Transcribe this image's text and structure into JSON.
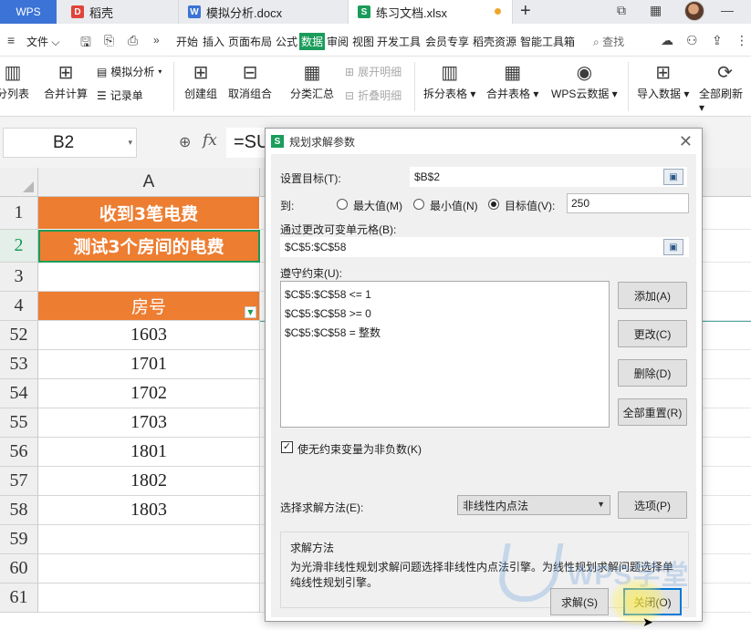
{
  "titlebar": {
    "app_tab": "WPS",
    "tabs": [
      {
        "label": "稻壳",
        "icon": "docer-icon"
      },
      {
        "label": "模拟分析.docx",
        "icon": "word-doc-icon"
      },
      {
        "label": "练习文档.xlsx",
        "icon": "sheet-doc-icon",
        "active": true
      }
    ]
  },
  "menubar": {
    "file": "文件",
    "items": [
      "开始",
      "插入",
      "页面布局",
      "公式",
      "数据",
      "审阅",
      "视图",
      "开发工具",
      "会员专享",
      "稻壳资源",
      "智能工具箱"
    ],
    "active_item": "数据",
    "search": "查找"
  },
  "ribbon": {
    "split_col": "分列表",
    "merge_calc": "合并计算",
    "what_if": "模拟分析",
    "record": "记录单",
    "group": "创建组",
    "ungroup": "取消组合",
    "subtotal": "分类汇总",
    "expand": "展开明细",
    "collapse": "折叠明细",
    "split_table": "拆分表格",
    "merge_table": "合并表格",
    "wps_cloud": "WPS云数据",
    "import": "导入数据",
    "refresh_all": "全部刷新"
  },
  "formula_bar": {
    "name_box": "B2",
    "fx": "fx",
    "formula": "=SUM("
  },
  "sheet": {
    "column_a": "A",
    "rows": [
      {
        "num": "1",
        "value": "收到3笔电费",
        "style": "orange"
      },
      {
        "num": "2",
        "value": "测试3个房间的电费",
        "style": "orange"
      },
      {
        "num": "3",
        "value": "",
        "style": "plain"
      },
      {
        "num": "4",
        "value": "房号",
        "style": "hdr"
      },
      {
        "num": "52",
        "value": "1603",
        "style": "plain"
      },
      {
        "num": "53",
        "value": "1701",
        "style": "plain"
      },
      {
        "num": "54",
        "value": "1702",
        "style": "plain"
      },
      {
        "num": "55",
        "value": "1703",
        "style": "plain"
      },
      {
        "num": "56",
        "value": "1801",
        "style": "plain"
      },
      {
        "num": "57",
        "value": "1802",
        "style": "plain"
      },
      {
        "num": "58",
        "value": "1803",
        "style": "plain"
      },
      {
        "num": "59",
        "value": "",
        "style": "plain"
      },
      {
        "num": "60",
        "value": "",
        "style": "plain"
      },
      {
        "num": "61",
        "value": "",
        "style": "plain"
      }
    ]
  },
  "dialog": {
    "title": "规划求解参数",
    "set_target_label": "设置目标(T):",
    "set_target_value": "$B$2",
    "to_label": "到:",
    "radio_max": "最大值(M)",
    "radio_min": "最小值(N)",
    "radio_value": "目标值(V):",
    "target_value": "250",
    "changing_cells_label": "通过更改可变单元格(B):",
    "changing_cells_value": "$C$5:$C$58",
    "constraints_label": "遵守约束(U):",
    "constraints": [
      "$C$5:$C$58 <= 1",
      "$C$5:$C$58 >= 0",
      "$C$5:$C$58 = 整数"
    ],
    "btn_add": "添加(A)",
    "btn_change": "更改(C)",
    "btn_delete": "删除(D)",
    "btn_reset": "全部重置(R)",
    "nonneg_label": "使无约束变量为非负数(K)",
    "nonneg_checked": true,
    "method_label": "选择求解方法(E):",
    "method_value": "非线性内点法",
    "btn_options": "选项(P)",
    "method_group_title": "求解方法",
    "method_desc": "为光滑非线性规划求解问题选择非线性内点法引擎。为线性规划求解问题选择单纯线性规划引擎。",
    "btn_solve": "求解(S)",
    "btn_close": "关闭(O)"
  },
  "watermark": {
    "text": "WPS学堂"
  },
  "colors": {
    "accent_green": "#1a9c5a",
    "orange_fill": "#ed7d31",
    "wps_blue": "#3b73d6"
  }
}
